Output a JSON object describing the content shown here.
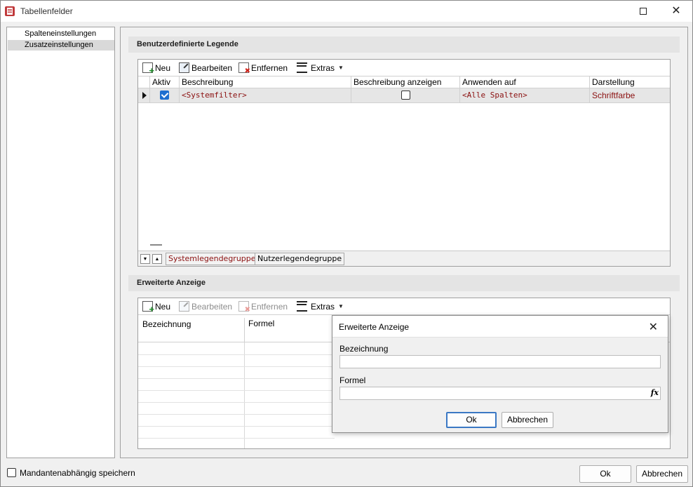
{
  "window": {
    "title": "Tabellenfelder"
  },
  "nav": {
    "items": [
      {
        "label": "Spalteneinstellungen",
        "selected": false
      },
      {
        "label": "Zusatzeinstellungen",
        "selected": true
      }
    ]
  },
  "legend_section": {
    "title": "Benutzerdefinierte Legende",
    "toolbar": {
      "new": "Neu",
      "edit": "Bearbeiten",
      "remove": "Entfernen",
      "extras": "Extras"
    },
    "columns": [
      "Aktiv",
      "Beschreibung",
      "Beschreibung anzeigen",
      "Anwenden auf",
      "Darstellung"
    ],
    "rows": [
      {
        "aktiv": true,
        "beschreibung": "<Systemfilter>",
        "beschreibung_anzeigen": false,
        "anwenden_auf": "<Alle Spalten>",
        "darstellung": "Schriftfarbe"
      }
    ],
    "groups": [
      "Systemlegendegruppe",
      "Nutzerlegendegruppe"
    ]
  },
  "extended_section": {
    "title": "Erweiterte Anzeige",
    "toolbar": {
      "new": "Neu",
      "edit": "Bearbeiten",
      "remove": "Entfernen",
      "extras": "Extras"
    },
    "columns": [
      "Bezeichnung",
      "Formel"
    ]
  },
  "popup": {
    "title": "Erweiterte Anzeige",
    "bezeichnung_label": "Bezeichnung",
    "bezeichnung_value": "",
    "formel_label": "Formel",
    "formel_value": "",
    "fx": "fx",
    "ok": "Ok",
    "cancel": "Abbrechen"
  },
  "footer": {
    "checkbox_label": "Mandantenabhängig speichern",
    "checked": false,
    "ok": "Ok",
    "cancel": "Abbrechen"
  },
  "colors": {
    "accent": "#1e6fd0",
    "system_text": "#8b1010"
  }
}
